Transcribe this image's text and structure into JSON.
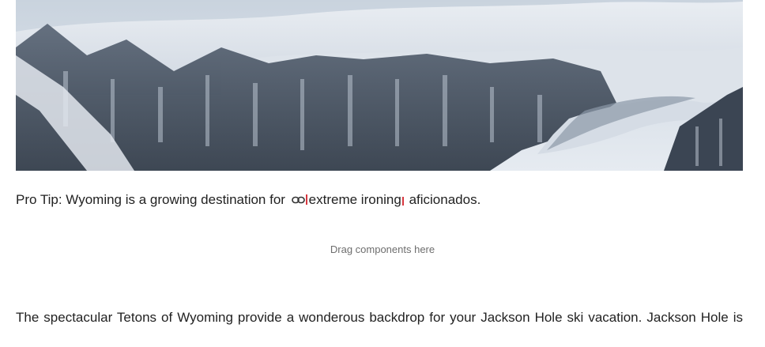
{
  "tip": {
    "prefix": "Pro Tip: Wyoming is a growing destination for ",
    "link_text": "extreme ironing",
    "suffix": " aficionados."
  },
  "dropzone": {
    "label": "Drag components here"
  },
  "article": {
    "paragraph_line": "The spectacular Tetons of Wyoming provide a wonderous backdrop for your Jackson Hole ski vacation.  Jackson Hole is"
  },
  "colors": {
    "marker": "#d7373f",
    "placeholder_text": "#6e6e6e"
  },
  "icons": {
    "link": "link-icon"
  }
}
